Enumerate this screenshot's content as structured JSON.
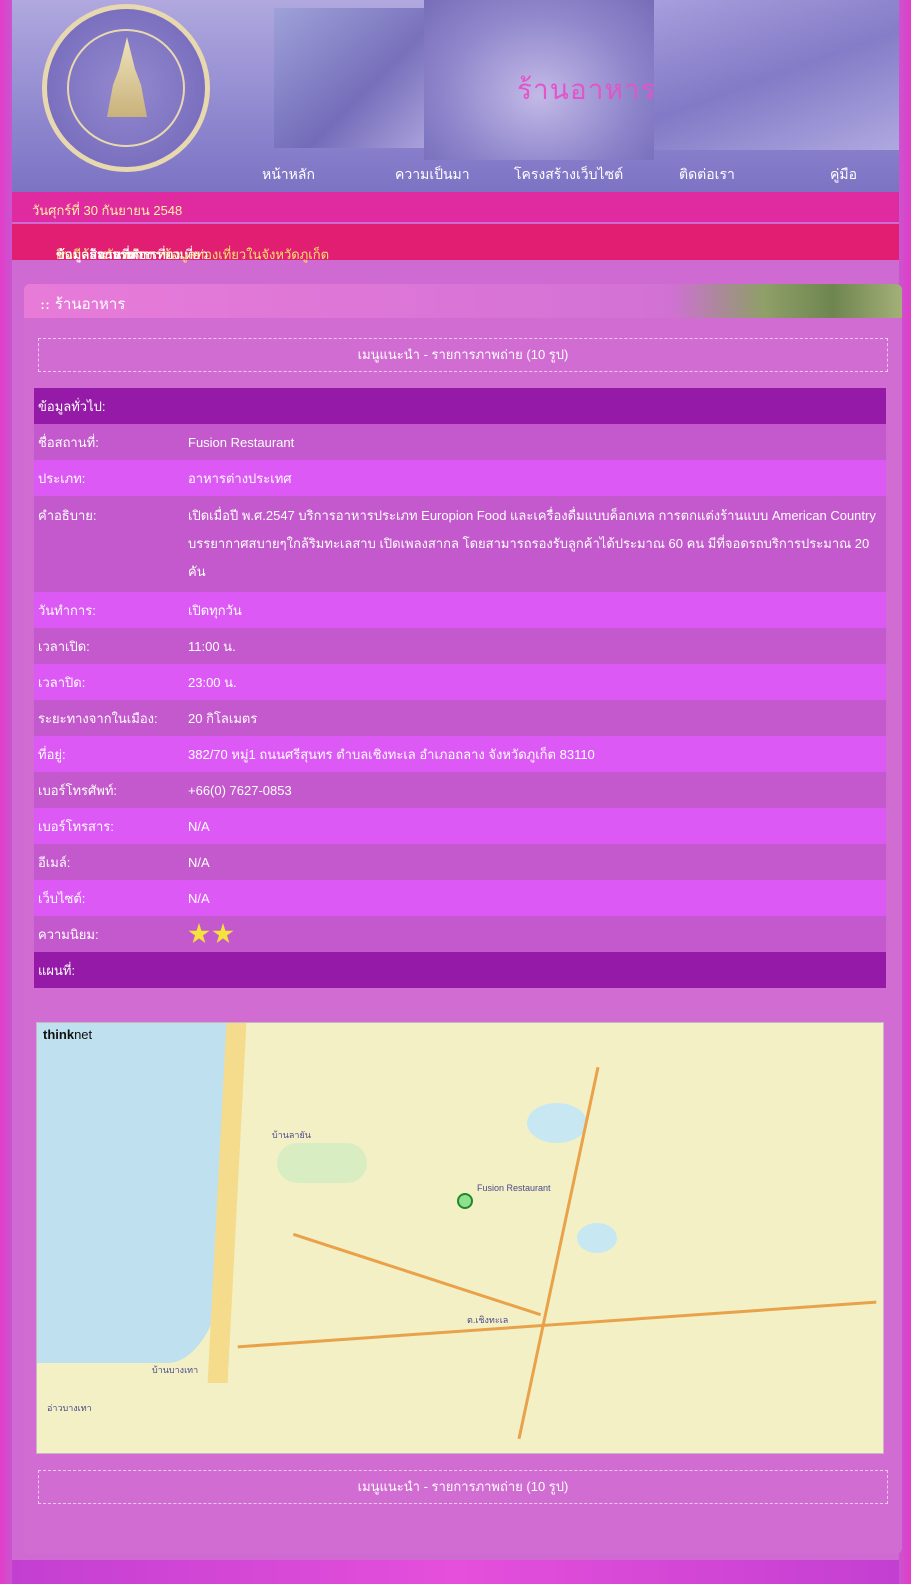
{
  "header": {
    "site_title": "ร้านอาหาร",
    "nav": [
      "หน้าหลัก",
      "ความเป็นมา",
      "โครงสร้างเว็บไซต์",
      "ติดต่อเรา",
      "คู่มือ"
    ]
  },
  "date_text": "วันศุกร์ที่ 30 กันยายน 2548",
  "marquee": {
    "prefix": "ยินดีต้อนรับ:บริการข้อมูลท่องเที่ยวในจังหวัดภูเก็ต",
    "links": [
      "ข้อมูลสถานที่ท่องเที่ยว",
      "ข้อมูลกิจกรรมการท่องเที่ยว",
      "ข้อมูลสถานที่พัก",
      "ข้อมูลร้านอาหาร"
    ]
  },
  "panel": {
    "title": ":: ร้านอาหาร",
    "menu_link": "เมนูแนะนำ - รายการภาพถ่าย (10 รูป)"
  },
  "info": {
    "section_general": "ข้อมูลทั่วไป:",
    "rows": [
      {
        "label": "ชื่อสถานที่:",
        "value": "Fusion Restaurant"
      },
      {
        "label": "ประเภท:",
        "value": "อาหารต่างประเทศ"
      },
      {
        "label": "คำอธิบาย:",
        "value": "เปิดเมื่อปี พ.ศ.2547 บริการอาหารประเภท Europion Food และเครื่องดื่มแบบค็อกเทล การตกแต่งร้านแบบ American Country บรรยากาศสบายๆใกล้ริมทะเลสาบ เปิดเพลงสากล โดยสามารถรองรับลูกค้าได้ประมาณ 60 คน มีที่จอดรถบริการประมาณ 20 คัน"
      },
      {
        "label": "วันทำการ:",
        "value": "เปิดทุกวัน"
      },
      {
        "label": "เวลาเปิด:",
        "value": "11:00  น."
      },
      {
        "label": "เวลาปิด:",
        "value": "23:00  น."
      },
      {
        "label": "ระยะทางจากในเมือง:",
        "value": "20  กิโลเมตร"
      },
      {
        "label": "ที่อยู่:",
        "value": "382/70 หมู่1 ถนนศรีสุนทร ตำบลเชิงทะเล อำเภอถลาง จังหวัดภูเก็ต 83110"
      },
      {
        "label": "เบอร์โทรศัพท์:",
        "value": "+66(0) 7627-0853"
      },
      {
        "label": "เบอร์โทรสาร:",
        "value": "N/A"
      },
      {
        "label": "อีเมล์:",
        "value": "N/A"
      },
      {
        "label": "เว็บไซต์:",
        "value": "N/A"
      },
      {
        "label": "ความนิยม:",
        "stars": 2
      }
    ],
    "section_map": "แผนที่:"
  },
  "map": {
    "logo_bold": "think",
    "logo_rest": "net",
    "labels": [
      "Fusion Restaurant",
      "ต.เชิงทะเล",
      "บ้านลายัน",
      "บ้านบางเทา",
      "อ่าวบางเทา"
    ]
  }
}
